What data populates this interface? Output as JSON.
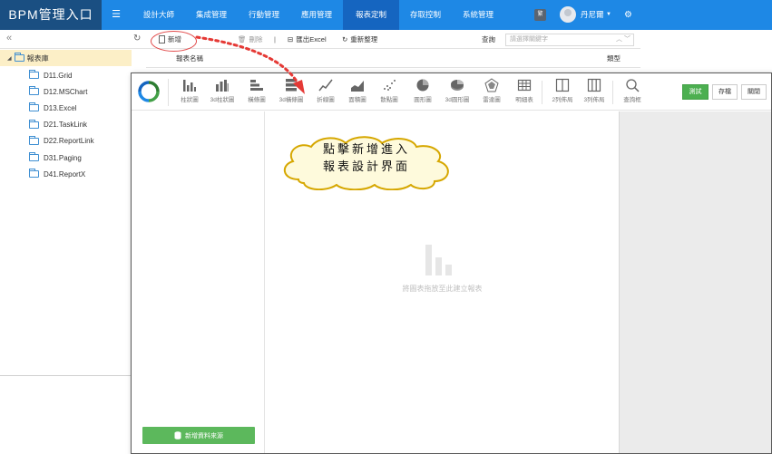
{
  "app": {
    "title": "BPM管理入口"
  },
  "nav": {
    "menu_icon": "hamburger-icon",
    "items": [
      "設計大師",
      "集成管理",
      "行動管理",
      "應用管理",
      "報表定制",
      "存取控制",
      "系統管理"
    ],
    "active": "報表定制"
  },
  "user": {
    "badge": "繁",
    "name": "丹尼爾"
  },
  "tree": {
    "root": "報表庫",
    "items": [
      "D11.Grid",
      "D12.MSChart",
      "D13.Excel",
      "D21.TaskLink",
      "D22.ReportLink",
      "D31.Paging",
      "D41.ReportX"
    ]
  },
  "toolbar": {
    "add_label": "新增",
    "delete_label": "刪除",
    "export_label": "匯出Excel",
    "reload_label": "重新整理",
    "search_label": "查詢",
    "search_placeholder": "請選擇關鍵字"
  },
  "table": {
    "columns": [
      "報表名稱",
      "類型"
    ]
  },
  "designer": {
    "tools": [
      {
        "label": "柱狀圖",
        "icon": "bar-chart-icon"
      },
      {
        "label": "3d柱狀圖",
        "icon": "bar-chart-3d-icon"
      },
      {
        "label": "橫條圖",
        "icon": "horizontal-bar-icon"
      },
      {
        "label": "3d橫條圖",
        "icon": "horizontal-bar-3d-icon"
      },
      {
        "label": "折線圖",
        "icon": "line-chart-icon"
      },
      {
        "label": "面積圖",
        "icon": "area-chart-icon"
      },
      {
        "label": "散點圖",
        "icon": "scatter-chart-icon"
      },
      {
        "label": "圓形圖",
        "icon": "pie-chart-icon"
      },
      {
        "label": "3d圓形圖",
        "icon": "pie-chart-3d-icon"
      },
      {
        "label": "雷達圖",
        "icon": "radar-chart-icon"
      },
      {
        "label": "明細表",
        "icon": "table-icon"
      },
      {
        "label": "2列佈局",
        "icon": "two-column-layout-icon"
      },
      {
        "label": "3列佈局",
        "icon": "three-column-layout-icon"
      },
      {
        "label": "查詢框",
        "icon": "search-icon"
      }
    ],
    "test_label": "測試",
    "save_label": "存檔",
    "close_label": "關閉",
    "add_datasource_label": "新增資料來源",
    "drop_hint": "將圖表拖放至此建立報表"
  },
  "callout": {
    "line1": "點擊新增進入",
    "line2": "報表設計界面"
  },
  "colors": {
    "brand": "#1a4f82",
    "nav": "#1e88e5",
    "nav_active": "#1565c0",
    "accent": "#4caf50",
    "highlight": "#e24b4b"
  }
}
